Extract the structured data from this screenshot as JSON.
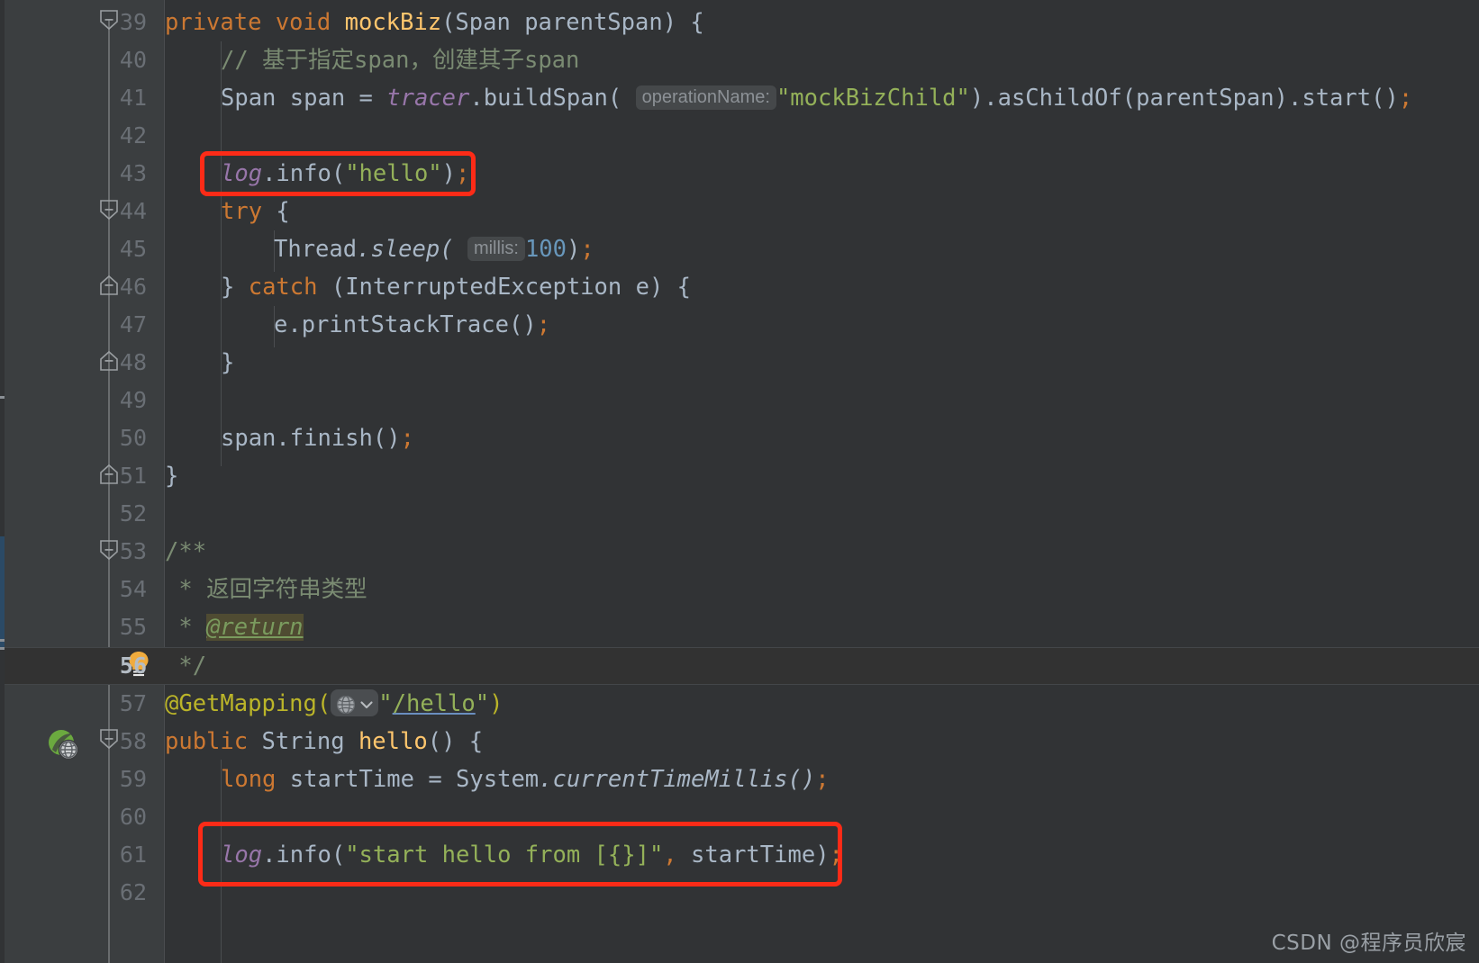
{
  "app": {
    "name": "IntelliJ IDEA Editor",
    "theme": "Darcula",
    "language": "Java"
  },
  "colors": {
    "background": "#313335",
    "gutter": "#3b3e40",
    "line_number": "#6a6f75",
    "keyword": "#cc7832",
    "method": "#ffc66d",
    "string": "#94b159",
    "number": "#6897bb",
    "comment": "#7a8b72",
    "field": "#9876aa",
    "annotation": "#bbb529",
    "default_text": "#a9b7c6",
    "highlight_box": "#fc2b17",
    "current_line": "#323232",
    "vcs_change": "#2b4a66"
  },
  "editor": {
    "first_line": 39,
    "last_line": 62,
    "current_line": 56,
    "lines": [
      {
        "n": 39,
        "fold": "start",
        "indent_guides": 0,
        "text": "private void mockBiz(Span parentSpan) {"
      },
      {
        "n": 40,
        "fold": "body",
        "indent_guides": 1,
        "text": "    // 基于指定span，创建其子span"
      },
      {
        "n": 41,
        "fold": "body",
        "indent_guides": 1,
        "text": "    Span span = tracer.buildSpan( operationName: \"mockBizChild\").asChildOf(parentSpan).start();"
      },
      {
        "n": 42,
        "fold": "body",
        "indent_guides": 1,
        "text": ""
      },
      {
        "n": 43,
        "fold": "body",
        "indent_guides": 1,
        "text": "    log.info(\"hello\");"
      },
      {
        "n": 44,
        "fold": "start",
        "indent_guides": 1,
        "text": "    try {"
      },
      {
        "n": 45,
        "fold": "body",
        "indent_guides": 2,
        "text": "        Thread.sleep( millis: 100);"
      },
      {
        "n": 46,
        "fold": "end-start",
        "indent_guides": 1,
        "text": "    } catch (InterruptedException e) {"
      },
      {
        "n": 47,
        "fold": "body",
        "indent_guides": 2,
        "text": "        e.printStackTrace();"
      },
      {
        "n": 48,
        "fold": "end",
        "indent_guides": 1,
        "text": "    }"
      },
      {
        "n": 49,
        "fold": "body",
        "indent_guides": 1,
        "text": ""
      },
      {
        "n": 50,
        "fold": "body",
        "indent_guides": 1,
        "text": "    span.finish();"
      },
      {
        "n": 51,
        "fold": "end",
        "indent_guides": 0,
        "text": "}"
      },
      {
        "n": 52,
        "fold": "none",
        "indent_guides": 0,
        "text": ""
      },
      {
        "n": 53,
        "fold": "start",
        "indent_guides": 0,
        "text": "/**"
      },
      {
        "n": 54,
        "fold": "body",
        "indent_guides": 0,
        "text": " * 返回字符串类型"
      },
      {
        "n": 55,
        "fold": "body",
        "indent_guides": 0,
        "text": " * @return"
      },
      {
        "n": 56,
        "fold": "end",
        "indent_guides": 0,
        "text": " */"
      },
      {
        "n": 57,
        "fold": "none",
        "indent_guides": 0,
        "text": "@GetMapping(\"/hello\")"
      },
      {
        "n": 58,
        "fold": "start",
        "indent_guides": 0,
        "text": "public String hello() {"
      },
      {
        "n": 59,
        "fold": "body",
        "indent_guides": 1,
        "text": "    long startTime = System.currentTimeMillis();"
      },
      {
        "n": 60,
        "fold": "body",
        "indent_guides": 1,
        "text": ""
      },
      {
        "n": 61,
        "fold": "body",
        "indent_guides": 1,
        "text": "    log.info(\"start hello from [{}]\", startTime);"
      },
      {
        "n": 62,
        "fold": "body",
        "indent_guides": 1,
        "text": ""
      }
    ]
  },
  "tokens": {
    "l39": {
      "kw1": "private",
      "kw2": "void",
      "method": "mockBiz",
      "params": "(Span parentSpan) {"
    },
    "l40": {
      "comment": "// 基于指定span，创建其子span"
    },
    "l41": {
      "type": "Span",
      "var": " span ",
      "eq": "= ",
      "field": "tracer",
      "call": ".buildSpan(",
      "hint": "operationName:",
      "string": "\"mockBizChild\"",
      "rest": ").asChildOf(parentSpan).start()",
      "semi": ";"
    },
    "l43": {
      "field": "log",
      "call": ".info(",
      "string": "\"hello\"",
      "close": ")",
      "semi": ";"
    },
    "l44": {
      "kw": "try",
      "brace": " {"
    },
    "l45": {
      "type": "Thread",
      "call": ".sleep(",
      "hint": "millis:",
      "num": "100",
      "close": ")",
      "semi": ";"
    },
    "l46": {
      "brace": "} ",
      "kw": "catch",
      "rest": " (InterruptedException e) {"
    },
    "l47": {
      "call": "e.printStackTrace()",
      "semi": ";"
    },
    "l48": {
      "brace": "}"
    },
    "l50": {
      "call": "span.finish()",
      "semi": ";"
    },
    "l51": {
      "brace": "}"
    },
    "l53": {
      "comment": "/**"
    },
    "l54": {
      "star": " * ",
      "comment": "返回字符串类型"
    },
    "l55": {
      "star": " * ",
      "tag": "@return"
    },
    "l56": {
      "comment": " */"
    },
    "l57": {
      "annotation": "@GetMapping",
      "open": "(",
      "icon": "globe-dropdown",
      "string_open": "\"",
      "path": "/hello",
      "string_close": "\"",
      "close": ")"
    },
    "l58": {
      "kw": "public",
      "type": " String ",
      "method": "hello",
      "rest": "() {"
    },
    "l59": {
      "kw": "long",
      "var": " startTime ",
      "eq": "= ",
      "type": "System",
      "call": ".currentTimeMillis()",
      "semi": ";"
    },
    "l61": {
      "field": "log",
      "call": ".info(",
      "string": "\"start hello from [{}]\"",
      "comma": ", ",
      "arg": "startTime",
      "close": ")",
      "semi": ";"
    }
  },
  "gutter_icons": [
    {
      "line": 56,
      "name": "intention-bulb-icon",
      "label": "Show Context Actions"
    },
    {
      "line": 58,
      "name": "spring-web-endpoint-run-icon",
      "label": "Run / Web Endpoint"
    }
  ],
  "annotations": {
    "highlight_boxes": [
      {
        "name": "highlight-box-log-hello",
        "line": 43,
        "label": "log.info(\"hello\");"
      },
      {
        "name": "highlight-box-log-start-hello",
        "line": 61,
        "label": "log.info(\"start hello from [{}]\", startTime);"
      }
    ]
  },
  "watermark": {
    "text": "CSDN @程序员欣宸"
  }
}
